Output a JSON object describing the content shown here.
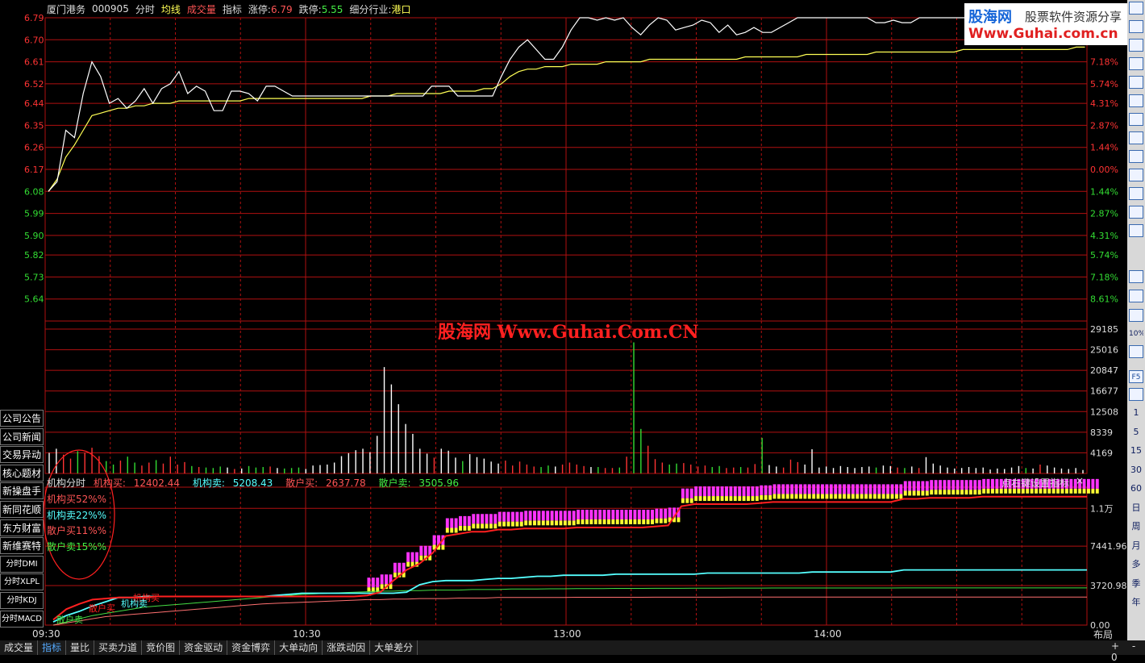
{
  "header": {
    "stock_name": "厦门港务",
    "stock_code": "000905",
    "mode": "分时",
    "avg_line": "均线",
    "volume_label": "成交量",
    "indicator": "指标",
    "limit_up_label": "涨停:",
    "limit_up_value": "6.79",
    "limit_down_label": "跌停:",
    "limit_down_value": "5.55",
    "industry_label": "细分行业:",
    "industry_value": "港口"
  },
  "logo": {
    "brand": "股海网",
    "slogan": "股票软件资源分享",
    "url": "Www.Guhai.com.cn"
  },
  "watermark": "股海网 Www.Guhai.Com.CN",
  "price_axis": {
    "labels": [
      "6.79",
      "6.70",
      "6.61",
      "6.52",
      "6.44",
      "6.35",
      "6.26",
      "6.17",
      "6.08",
      "5.99",
      "5.90",
      "5.82",
      "5.73",
      "5.64"
    ],
    "prev_close": 6.17,
    "min": 5.55,
    "max": 6.79
  },
  "pct_axis": {
    "labels": [
      "7.18%",
      "5.74%",
      "4.31%",
      "2.87%",
      "1.44%",
      "0.00%",
      "1.44%",
      "2.87%",
      "4.31%",
      "5.74%",
      "7.18%",
      "8.61%"
    ],
    "top_label": "8.61%"
  },
  "volume_axis": {
    "labels": [
      "29185",
      "25016",
      "20847",
      "16677",
      "12508",
      "8339",
      "4169"
    ],
    "max": 29185
  },
  "indicator_axis": {
    "labels": [
      "1.1万",
      "7441.96",
      "3720.98",
      "0.00"
    ],
    "max": 13000
  },
  "time_axis": {
    "labels": [
      "09:30",
      "10:30",
      "13:00",
      "14:00"
    ]
  },
  "indicator_panel": {
    "name": "机构分时",
    "inst_buy_label": "机构买:",
    "inst_buy_value": "12402.44",
    "inst_sell_label": "机构卖:",
    "inst_sell_value": "5208.43",
    "retail_buy_label": "散户买:",
    "retail_buy_value": "2637.78",
    "retail_sell_label": "散户卖:",
    "retail_sell_value": "3505.96",
    "hint": "点右键设置指标",
    "close": "×",
    "percentages": [
      {
        "label": "机构买52%%",
        "color": "#ff5555"
      },
      {
        "label": "机构卖22%%",
        "color": "#55ffff"
      },
      {
        "label": "散户买11%%",
        "color": "#ff5555"
      },
      {
        "label": "散户卖15%%",
        "color": "#44ee44"
      }
    ],
    "inline_labels": [
      "机构买",
      "机构卖",
      "散户买",
      "散户卖"
    ]
  },
  "left_menu": [
    "公司公告",
    "公司新闻",
    "交易异动",
    "核心题材",
    "新操盘手",
    "新同花顺",
    "东方财富",
    "新维赛特",
    "分时DMI",
    "分时XLPL",
    "分时KDJ",
    "分时MACD"
  ],
  "bottom_tabs": [
    "成交量",
    "指标",
    "量比",
    "买卖力道",
    "竞价图",
    "资金驱动",
    "资金博弈",
    "大单动向",
    "涨跌动因",
    "大单差分"
  ],
  "bottom_active": "指标",
  "layout_label": "布局",
  "zoom_controls": [
    "+",
    "-",
    "0"
  ],
  "right_toolbar": [
    "1",
    "5",
    "15",
    "30",
    "60",
    "日",
    "周",
    "月",
    "多",
    "季",
    "年"
  ],
  "right_toolbar_percent": "10%",
  "right_toolbar_f5": "F5",
  "colors": {
    "grid": "#b01010",
    "price_line": "#ffffff",
    "avg_line": "#ffff55",
    "up": "#ff3333",
    "down": "#33dd33",
    "inst_buy": "#ff2020",
    "inst_sell": "#55ffff",
    "retail_buy": "#ff7070",
    "retail_sell": "#44dd44",
    "bar_magenta": "#ff33ff",
    "bar_yellow": "#ffff33"
  },
  "chart_data": {
    "type": "line",
    "price_series": [
      6.08,
      6.12,
      6.33,
      6.3,
      6.48,
      6.61,
      6.55,
      6.44,
      6.46,
      6.42,
      6.45,
      6.5,
      6.44,
      6.5,
      6.52,
      6.57,
      6.48,
      6.51,
      6.49,
      6.41,
      6.41,
      6.49,
      6.49,
      6.48,
      6.45,
      6.51,
      6.51,
      6.49,
      6.47,
      6.47,
      6.47,
      6.47,
      6.47,
      6.47,
      6.47,
      6.47,
      6.47,
      6.47,
      6.47,
      6.47,
      6.47,
      6.47,
      6.47,
      6.47,
      6.51,
      6.51,
      6.51,
      6.47,
      6.47,
      6.47,
      6.47,
      6.47,
      6.55,
      6.62,
      6.67,
      6.7,
      6.66,
      6.62,
      6.62,
      6.67,
      6.74,
      6.79,
      6.79,
      6.78,
      6.79,
      6.78,
      6.79,
      6.75,
      6.72,
      6.76,
      6.79,
      6.78,
      6.74,
      6.75,
      6.76,
      6.78,
      6.77,
      6.73,
      6.76,
      6.72,
      6.73,
      6.75,
      6.73,
      6.73,
      6.75,
      6.77,
      6.79,
      6.79,
      6.79,
      6.79,
      6.79,
      6.79,
      6.79,
      6.79,
      6.79,
      6.77,
      6.77,
      6.78,
      6.77,
      6.77,
      6.79,
      6.79,
      6.79,
      6.79,
      6.79,
      6.79,
      6.79,
      6.79,
      6.79,
      6.79,
      6.79,
      6.79,
      6.78,
      6.78,
      6.79,
      6.79,
      6.79,
      6.79,
      6.79,
      6.79
    ],
    "avg_series": [
      6.08,
      6.13,
      6.22,
      6.27,
      6.33,
      6.39,
      6.4,
      6.41,
      6.42,
      6.42,
      6.43,
      6.43,
      6.44,
      6.44,
      6.44,
      6.45,
      6.45,
      6.45,
      6.45,
      6.45,
      6.45,
      6.45,
      6.45,
      6.46,
      6.46,
      6.46,
      6.46,
      6.46,
      6.46,
      6.46,
      6.46,
      6.46,
      6.46,
      6.46,
      6.46,
      6.46,
      6.46,
      6.47,
      6.47,
      6.47,
      6.48,
      6.48,
      6.48,
      6.48,
      6.48,
      6.48,
      6.49,
      6.49,
      6.49,
      6.49,
      6.5,
      6.5,
      6.52,
      6.55,
      6.57,
      6.58,
      6.58,
      6.59,
      6.59,
      6.59,
      6.6,
      6.6,
      6.6,
      6.6,
      6.61,
      6.61,
      6.61,
      6.61,
      6.61,
      6.62,
      6.62,
      6.62,
      6.62,
      6.62,
      6.62,
      6.62,
      6.62,
      6.62,
      6.62,
      6.62,
      6.63,
      6.63,
      6.63,
      6.63,
      6.63,
      6.63,
      6.63,
      6.64,
      6.64,
      6.64,
      6.64,
      6.64,
      6.64,
      6.64,
      6.64,
      6.65,
      6.65,
      6.65,
      6.65,
      6.65,
      6.65,
      6.65,
      6.65,
      6.65,
      6.65,
      6.66,
      6.66,
      6.66,
      6.66,
      6.66,
      6.66,
      6.66,
      6.66,
      6.66,
      6.66,
      6.66,
      6.66,
      6.66,
      6.67,
      6.67
    ],
    "volume_series": [
      4169,
      5000,
      3800,
      3000,
      4500,
      4200,
      5200,
      3500,
      2500,
      1800,
      2600,
      3400,
      2200,
      1600,
      2200,
      2700,
      2000,
      3400,
      1800,
      2300,
      1500,
      1300,
      1200,
      1100,
      1400,
      1200,
      900,
      1000,
      1500,
      1200,
      1300,
      1400,
      1100,
      1000,
      1100,
      1200,
      900,
      1600,
      1700,
      1800,
      2200,
      3500,
      4100,
      4700,
      5000,
      4300,
      7600,
      21500,
      18000,
      14000,
      10000,
      8000,
      5000,
      4000,
      3200,
      5000,
      4600,
      3200,
      2500,
      3900,
      3300,
      3000,
      2400,
      2000,
      2600,
      1600,
      2400,
      1800,
      1400,
      1300,
      1600,
      1400,
      1800,
      2200,
      1800,
      1500,
      1300,
      1300,
      1100,
      1100,
      1200,
      3400,
      26500,
      9000,
      5600,
      2900,
      2200,
      1800,
      2000,
      2100,
      1800,
      1400,
      1600,
      1300,
      1500,
      1100,
      1200,
      1300,
      1200,
      1900,
      7200,
      1700,
      1400,
      1200,
      2800,
      2300,
      1800,
      4900,
      1200,
      1400,
      1100,
      1500,
      1300,
      1100,
      1300,
      1400,
      1200,
      1600,
      1500,
      1200,
      1100,
      1400,
      1100,
      3300,
      2000,
      1600,
      1200,
      1000,
      1100,
      1300,
      1100,
      1200,
      800,
      1000,
      900,
      1200,
      1500,
      1100,
      1000,
      1800,
      1600,
      1200,
      1000,
      900,
      1100,
      700
    ],
    "inst_buy_series": [
      500,
      1500,
      2000,
      2400,
      2500,
      2600,
      2600,
      2600,
      2700,
      2700,
      2700,
      2700,
      2700,
      2700,
      2700,
      2700,
      2700,
      2700,
      2700,
      2700,
      2700,
      2700,
      2700,
      2700,
      2800,
      3100,
      4200,
      5200,
      5800,
      6800,
      8400,
      8600,
      8800,
      8800,
      9000,
      9000,
      9100,
      9100,
      9100,
      9100,
      9200,
      9200,
      9200,
      9200,
      9200,
      9200,
      9300,
      9400,
      11200,
      11400,
      11400,
      11400,
      11400,
      11400,
      11500,
      11600,
      11600,
      11600,
      11600,
      11600,
      11600,
      11600,
      11600,
      11600,
      11600,
      11900,
      11900,
      12000,
      12000,
      12000,
      12000,
      12100,
      12100,
      12100,
      12100,
      12100,
      12100,
      12100,
      12100,
      12100
    ],
    "inst_sell_series": [
      300,
      900,
      1300,
      1800,
      2200,
      2600,
      2600,
      2700,
      2700,
      2700,
      2700,
      2700,
      2700,
      2700,
      2700,
      2700,
      2700,
      2800,
      2900,
      3000,
      3000,
      3000,
      3000,
      3000,
      3000,
      3000,
      3000,
      3100,
      3800,
      4100,
      4200,
      4200,
      4200,
      4300,
      4400,
      4400,
      4500,
      4600,
      4600,
      4700,
      4700,
      4700,
      4700,
      4800,
      4800,
      4800,
      4800,
      4800,
      4800,
      4800,
      4900,
      4900,
      4900,
      4900,
      4900,
      4900,
      4900,
      4900,
      5000,
      5000,
      5000,
      5000,
      5000,
      5000,
      5000,
      5200,
      5200,
      5200,
      5200,
      5200,
      5200,
      5200,
      5200,
      5200,
      5200,
      5200,
      5200,
      5200,
      5200,
      5200
    ],
    "retail_buy_series": [
      0,
      200,
      400,
      600,
      800,
      900,
      1000,
      1100,
      1200,
      1300,
      1400,
      1500,
      1600,
      1700,
      1800,
      1900,
      2000,
      2050,
      2100,
      2150,
      2200,
      2250,
      2300,
      2350,
      2400,
      2400,
      2450,
      2450,
      2500,
      2500,
      2500,
      2550,
      2550,
      2550,
      2600,
      2600,
      2600,
      2600,
      2600,
      2600,
      2620,
      2620,
      2620,
      2620,
      2620,
      2620,
      2630,
      2630,
      2630,
      2630,
      2630,
      2630,
      2635,
      2635,
      2635,
      2635,
      2635,
      2635,
      2637,
      2637,
      2637,
      2637,
      2637,
      2637,
      2637,
      2637,
      2637,
      2637,
      2637,
      2637,
      2637,
      2637,
      2637,
      2637,
      2637,
      2637,
      2637,
      2637,
      2637,
      2637
    ],
    "retail_sell_series": [
      0,
      300,
      600,
      900,
      1100,
      1300,
      1500,
      1700,
      1800,
      1900,
      2000,
      2100,
      2200,
      2300,
      2400,
      2500,
      2600,
      2700,
      2800,
      2900,
      2950,
      3000,
      3050,
      3100,
      3150,
      3200,
      3200,
      3250,
      3250,
      3300,
      3300,
      3300,
      3350,
      3350,
      3350,
      3400,
      3400,
      3400,
      3420,
      3420,
      3440,
      3440,
      3440,
      3460,
      3460,
      3460,
      3470,
      3470,
      3470,
      3480,
      3480,
      3480,
      3490,
      3490,
      3490,
      3495,
      3495,
      3495,
      3500,
      3500,
      3500,
      3500,
      3500,
      3500,
      3500,
      3505,
      3505,
      3505,
      3505,
      3505,
      3505,
      3505,
      3505,
      3505,
      3505,
      3505,
      3505,
      3505,
      3505,
      3505
    ]
  }
}
